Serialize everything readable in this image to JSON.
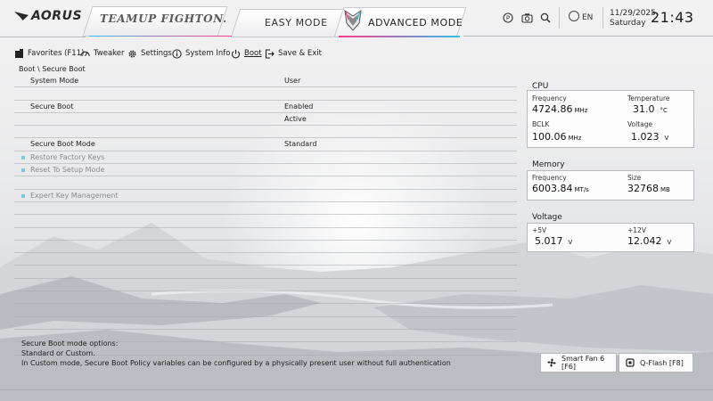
{
  "header": {
    "brand": "AORUS",
    "team_label": "TEAMUP FIGHTON.",
    "modes": {
      "easy": "EASY MODE",
      "advanced": "ADVANCED MODE"
    },
    "language": "EN",
    "date": "11/29/2025",
    "day": "Saturday",
    "time": "21:43",
    "accent_colors": [
      "#ff3a8c",
      "#35c0e8"
    ]
  },
  "menu": {
    "favorites": "Favorites (F11)",
    "tweaker": "Tweaker",
    "settings": "Settings",
    "system_info": "System Info",
    "boot": "Boot",
    "save_exit": "Save & Exit"
  },
  "breadcrumb": "Boot \\ Secure Boot",
  "settings_rows": [
    {
      "label": "System Mode",
      "value": "User",
      "bullet": false,
      "dim": false
    },
    {
      "label": "",
      "value": "",
      "bullet": false,
      "dim": false
    },
    {
      "label": "Secure Boot",
      "value": "Enabled",
      "bullet": false,
      "dim": false
    },
    {
      "label": "",
      "value": "Active",
      "bullet": false,
      "dim": false
    },
    {
      "label": "",
      "value": "",
      "bullet": false,
      "dim": false
    },
    {
      "label": "Secure Boot Mode",
      "value": "Standard",
      "bullet": false,
      "dim": false
    },
    {
      "label": "Restore Factory Keys",
      "value": "",
      "bullet": true,
      "dim": true
    },
    {
      "label": "Reset To Setup Mode",
      "value": "",
      "bullet": true,
      "dim": true
    },
    {
      "label": "",
      "value": "",
      "bullet": false,
      "dim": false
    },
    {
      "label": "Expert Key Management",
      "value": "",
      "bullet": true,
      "dim": true
    },
    {
      "label": "",
      "value": "",
      "bullet": false,
      "dim": false
    },
    {
      "label": "",
      "value": "",
      "bullet": false,
      "dim": false
    },
    {
      "label": "",
      "value": "",
      "bullet": false,
      "dim": false
    },
    {
      "label": "",
      "value": "",
      "bullet": false,
      "dim": false
    },
    {
      "label": "",
      "value": "",
      "bullet": false,
      "dim": false
    },
    {
      "label": "",
      "value": "",
      "bullet": false,
      "dim": false
    },
    {
      "label": "",
      "value": "",
      "bullet": false,
      "dim": false
    },
    {
      "label": "",
      "value": "",
      "bullet": false,
      "dim": false
    },
    {
      "label": "",
      "value": "",
      "bullet": false,
      "dim": false
    },
    {
      "label": "",
      "value": "",
      "bullet": false,
      "dim": false
    },
    {
      "label": "",
      "value": "",
      "bullet": false,
      "dim": false
    },
    {
      "label": "",
      "value": "",
      "bullet": false,
      "dim": false
    }
  ],
  "cpu": {
    "title": "CPU",
    "frequency_label": "Frequency",
    "frequency": "4724.86",
    "frequency_unit": "MHz",
    "temperature_label": "Temperature",
    "temperature": "31.0",
    "temperature_unit": "°C",
    "bclk_label": "BCLK",
    "bclk": "100.06",
    "bclk_unit": "MHz",
    "voltage_label": "Voltage",
    "voltage": "1.023",
    "voltage_unit": "V"
  },
  "memory": {
    "title": "Memory",
    "frequency_label": "Frequency",
    "frequency": "6003.84",
    "frequency_unit": "MT/s",
    "size_label": "Size",
    "size": "32768",
    "size_unit": "MB"
  },
  "voltage": {
    "title": "Voltage",
    "v5_label": "+5V",
    "v5": "5.017",
    "v5_unit": "V",
    "v12_label": "+12V",
    "v12": "12.042",
    "v12_unit": "V"
  },
  "help": {
    "line1": "Secure Boot mode options:",
    "line2": "Standard or Custom.",
    "line3": "In Custom mode, Secure Boot Policy variables can be configured by a physically present user without full authentication"
  },
  "buttons": {
    "smart_fan": "Smart Fan 6 [F6]",
    "qflash": "Q-Flash [F8]"
  }
}
